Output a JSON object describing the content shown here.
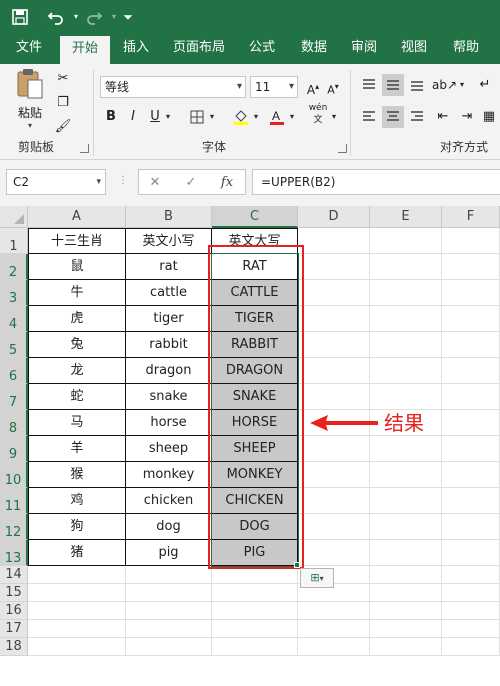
{
  "quick_access": {
    "save_icon": "save-icon",
    "undo_icon": "undo-icon",
    "redo_icon": "redo-icon",
    "customize_icon": "customize-qat-icon"
  },
  "tabs": [
    {
      "label": "文件"
    },
    {
      "label": "开始"
    },
    {
      "label": "插入"
    },
    {
      "label": "页面布局"
    },
    {
      "label": "公式"
    },
    {
      "label": "数据"
    },
    {
      "label": "审阅"
    },
    {
      "label": "视图"
    },
    {
      "label": "帮助"
    }
  ],
  "ribbon": {
    "clipboard": {
      "paste_label": "粘贴",
      "group_label": "剪贴板"
    },
    "font": {
      "font_name": "等线",
      "font_size": "11",
      "bold": "B",
      "italic": "I",
      "underline": "U",
      "pinyin": "wén",
      "group_label": "字体"
    },
    "alignment": {
      "group_label": "对齐方式"
    }
  },
  "formula_bar": {
    "name_box": "C2",
    "fx_label": "fx",
    "formula": "=UPPER(B2)"
  },
  "columns": [
    "A",
    "B",
    "C",
    "D",
    "E",
    "F"
  ],
  "rows": [
    "1",
    "2",
    "3",
    "4",
    "5",
    "6",
    "7",
    "8",
    "9",
    "10",
    "11",
    "12",
    "13",
    "14",
    "15",
    "16",
    "17",
    "18"
  ],
  "table": {
    "headers": [
      "十三生肖",
      "英文小写",
      "英文大写"
    ],
    "rows": [
      [
        "鼠",
        "rat",
        "RAT"
      ],
      [
        "牛",
        "cattle",
        "CATTLE"
      ],
      [
        "虎",
        "tiger",
        "TIGER"
      ],
      [
        "兔",
        "rabbit",
        "RABBIT"
      ],
      [
        "龙",
        "dragon",
        "DRAGON"
      ],
      [
        "蛇",
        "snake",
        "SNAKE"
      ],
      [
        "马",
        "horse",
        "HORSE"
      ],
      [
        "羊",
        "sheep",
        "SHEEP"
      ],
      [
        "猴",
        "monkey",
        "MONKEY"
      ],
      [
        "鸡",
        "chicken",
        "CHICKEN"
      ],
      [
        "狗",
        "dog",
        "DOG"
      ],
      [
        "猪",
        "pig",
        "PIG"
      ]
    ]
  },
  "annotation": {
    "text": "结果"
  },
  "colors": {
    "excel_green": "#217346",
    "highlight": "#c8c8c8",
    "annotation_red": "#e8211f"
  }
}
